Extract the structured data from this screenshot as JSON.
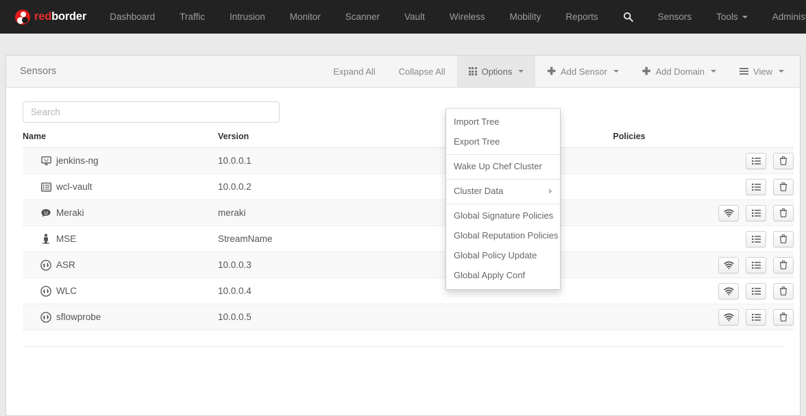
{
  "navbar": {
    "brand": {
      "red_part": "red",
      "white_part": "border"
    },
    "links": [
      {
        "label": "Dashboard"
      },
      {
        "label": "Traffic"
      },
      {
        "label": "Intrusion"
      },
      {
        "label": "Monitor"
      },
      {
        "label": "Scanner"
      },
      {
        "label": "Vault"
      },
      {
        "label": "Wireless"
      },
      {
        "label": "Mobility"
      },
      {
        "label": "Reports"
      }
    ],
    "right": {
      "search_icon": "search-icon",
      "sensors_label": "Sensors",
      "tools_label": "Tools",
      "user_label": "Administrator",
      "avatar_icon": "user-avatar"
    },
    "background": "#222222",
    "accent": "#e01b1b"
  },
  "panel": {
    "title": "Sensors",
    "toolbar": [
      {
        "label": "Expand All",
        "icon": null,
        "caret": false,
        "active": false
      },
      {
        "label": "Collapse All",
        "icon": null,
        "caret": false,
        "active": false
      },
      {
        "label": "Options",
        "icon": "grid-icon",
        "caret": true,
        "active": true
      },
      {
        "label": "Add Sensor",
        "icon": "plus-icon",
        "caret": true,
        "active": false
      },
      {
        "label": "Add Domain",
        "icon": "plus-icon",
        "caret": true,
        "active": false
      },
      {
        "label": "View",
        "icon": "list-icon",
        "caret": true,
        "active": false
      }
    ]
  },
  "options_menu": {
    "items": [
      {
        "label": "Import Tree",
        "divider_above": false,
        "submenu": false
      },
      {
        "label": "Export Tree",
        "divider_above": false,
        "submenu": false
      },
      {
        "label": "Wake Up Chef Cluster",
        "divider_above": true,
        "submenu": false
      },
      {
        "label": "Cluster Data",
        "divider_above": true,
        "submenu": true
      },
      {
        "label": "Global Signature Policies",
        "divider_above": true,
        "submenu": false
      },
      {
        "label": "Global Reputation Policies",
        "divider_above": false,
        "submenu": false
      },
      {
        "label": "Global Policy Update",
        "divider_above": false,
        "submenu": false
      },
      {
        "label": "Global Apply Conf",
        "divider_above": false,
        "submenu": false
      }
    ]
  },
  "search": {
    "value": "",
    "placeholder": "Search"
  },
  "table": {
    "headers": {
      "name": "Name",
      "version": "Version",
      "policies": "Policies"
    },
    "rows": [
      {
        "icon": "desktop-icon",
        "name": "jenkins-ng",
        "version": "10.0.0.1",
        "actions": [
          "list-icon",
          "trash-icon"
        ]
      },
      {
        "icon": "list-alt-icon",
        "name": "wcl-vault",
        "version": "10.0.0.2",
        "actions": [
          "list-icon",
          "trash-icon"
        ]
      },
      {
        "icon": "cloud-comment-icon",
        "name": "Meraki",
        "version": "meraki",
        "actions": [
          "wifi-icon",
          "list-icon",
          "trash-icon"
        ]
      },
      {
        "icon": "person-icon",
        "name": "MSE",
        "version": "StreamName",
        "actions": [
          "list-icon",
          "trash-icon"
        ]
      },
      {
        "icon": "exchange-circle-icon",
        "name": "ASR",
        "version": "10.0.0.3",
        "actions": [
          "wifi-icon",
          "list-icon",
          "trash-icon"
        ]
      },
      {
        "icon": "exchange-circle-icon",
        "name": "WLC",
        "version": "10.0.0.4",
        "actions": [
          "wifi-icon",
          "list-icon",
          "trash-icon"
        ]
      },
      {
        "icon": "exchange-circle-icon",
        "name": "sflowprobe",
        "version": "10.0.0.5",
        "actions": [
          "wifi-icon",
          "list-icon",
          "trash-icon"
        ]
      }
    ]
  }
}
